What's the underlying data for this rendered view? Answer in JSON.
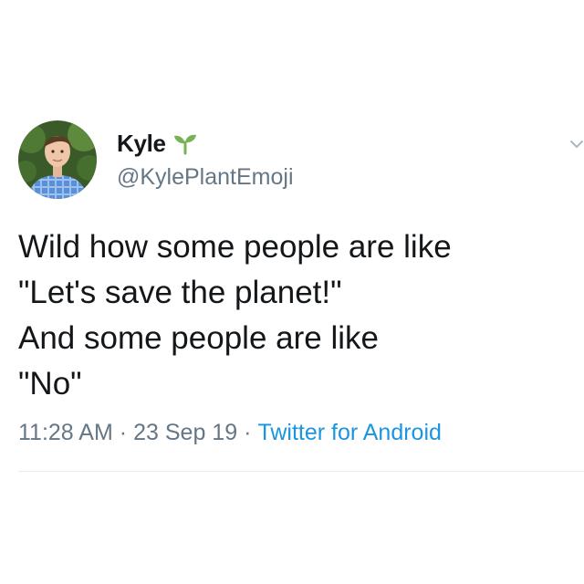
{
  "tweet": {
    "author": {
      "display_name": "Kyle",
      "name_emoji_icon": "seedling-icon",
      "handle": "@KylePlantEmoji"
    },
    "text_lines": [
      "Wild how some people are like",
      "\"Let's save the planet!\"",
      "And some people are like",
      "\"No\""
    ],
    "meta": {
      "time": "11:28 AM",
      "separator": "·",
      "date": "23 Sep 19",
      "source": "Twitter for Android"
    },
    "menu_icon": "chevron-down-icon"
  },
  "colors": {
    "text_primary": "#14171a",
    "text_secondary": "#657786",
    "link": "#1b95e0",
    "divider": "#e6ecf0",
    "seedling": "#77b255"
  }
}
